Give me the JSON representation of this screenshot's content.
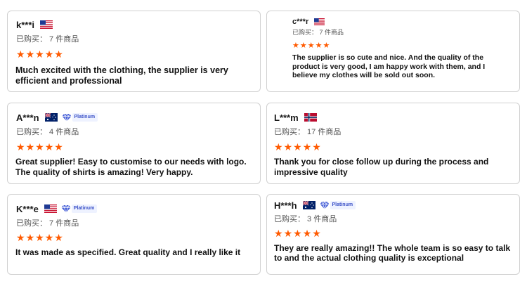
{
  "reviews": [
    {
      "name": "k***i",
      "country": "US",
      "platinum": false,
      "bought": "已购买： 7 件商品",
      "rating": 5,
      "text": "Much excited with the clothing, the supplier is very efficient and professional"
    },
    {
      "name": "c***r",
      "country": "US",
      "platinum": false,
      "bought": "已购买： 7 件商品",
      "rating": 5,
      "text": "The supplier is so cute and nice. And the quality of the product is very good, I am happy work with them, and I believe my clothes will be sold out soon."
    },
    {
      "name": "A***n",
      "country": "AU",
      "platinum": true,
      "platinum_label": "Platinum",
      "bought": "已购买： 4 件商品",
      "rating": 5,
      "text": "Great supplier! Easy to customise to our needs with logo. The quality of shirts is amazing! Very happy."
    },
    {
      "name": "L***m",
      "country": "NO",
      "platinum": false,
      "bought": "已购买： 17 件商品",
      "rating": 5,
      "text": "Thank you for close follow up during the  process and impressive quality"
    },
    {
      "name": "K***e",
      "country": "US",
      "platinum": true,
      "platinum_label": "Platinum",
      "bought": "已购买： 7 件商品",
      "rating": 5,
      "text": "It was made as specified. Great  quality and I really like it"
    },
    {
      "name": "H***h",
      "country": "AU",
      "platinum": true,
      "platinum_label": "Platinum",
      "bought": "已购买： 3 件商品",
      "rating": 5,
      "text": "They are really amazing!! The whole team is so easy to talk to and the actual clothing quality is exceptional"
    }
  ],
  "colors": {
    "star": "#ff5a00",
    "border": "#d0d0d0",
    "platinum": "#3c52c8"
  }
}
